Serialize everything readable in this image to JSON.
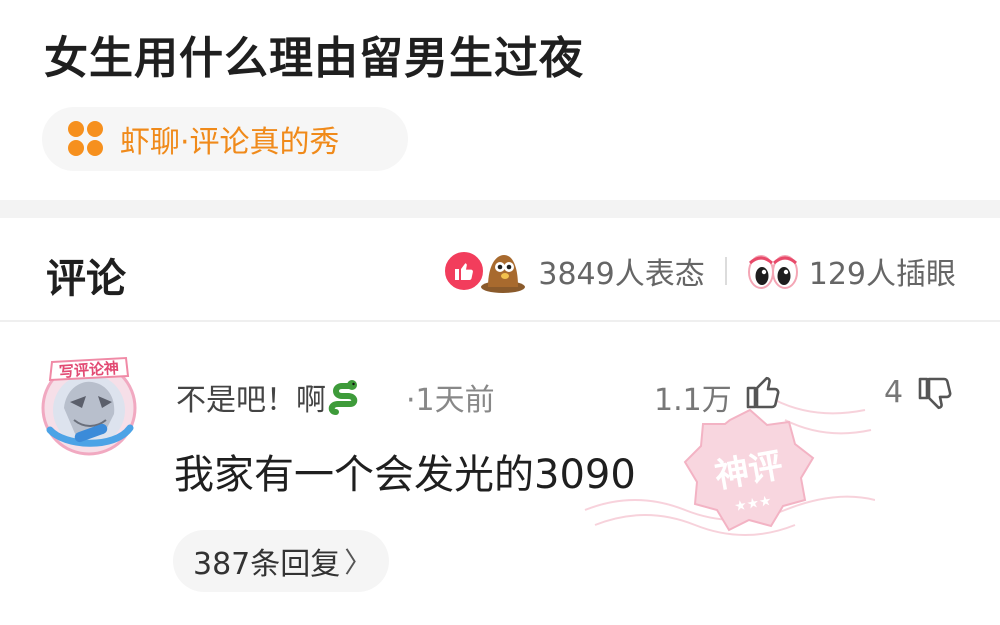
{
  "post": {
    "title": "女生用什么理由留男生过夜",
    "source_label": "虾聊·评论真的秀",
    "source_icon": "four-dots-icon",
    "accent_color": "#f08a1a"
  },
  "comments_section": {
    "heading": "评论",
    "reactions_label": "3849人表态",
    "eyes_label": "129人插眼"
  },
  "comment": {
    "avatar_badge": "写评论神",
    "username": "不是吧！啊",
    "time": "·1天前",
    "likes": "1.1万",
    "replies_count": "4",
    "stamp_text": "神评",
    "stamp_stars": "★★★",
    "body": "我家有一个会发光的3090",
    "replies_label": "387条回复",
    "replies_chevron": "〉"
  }
}
